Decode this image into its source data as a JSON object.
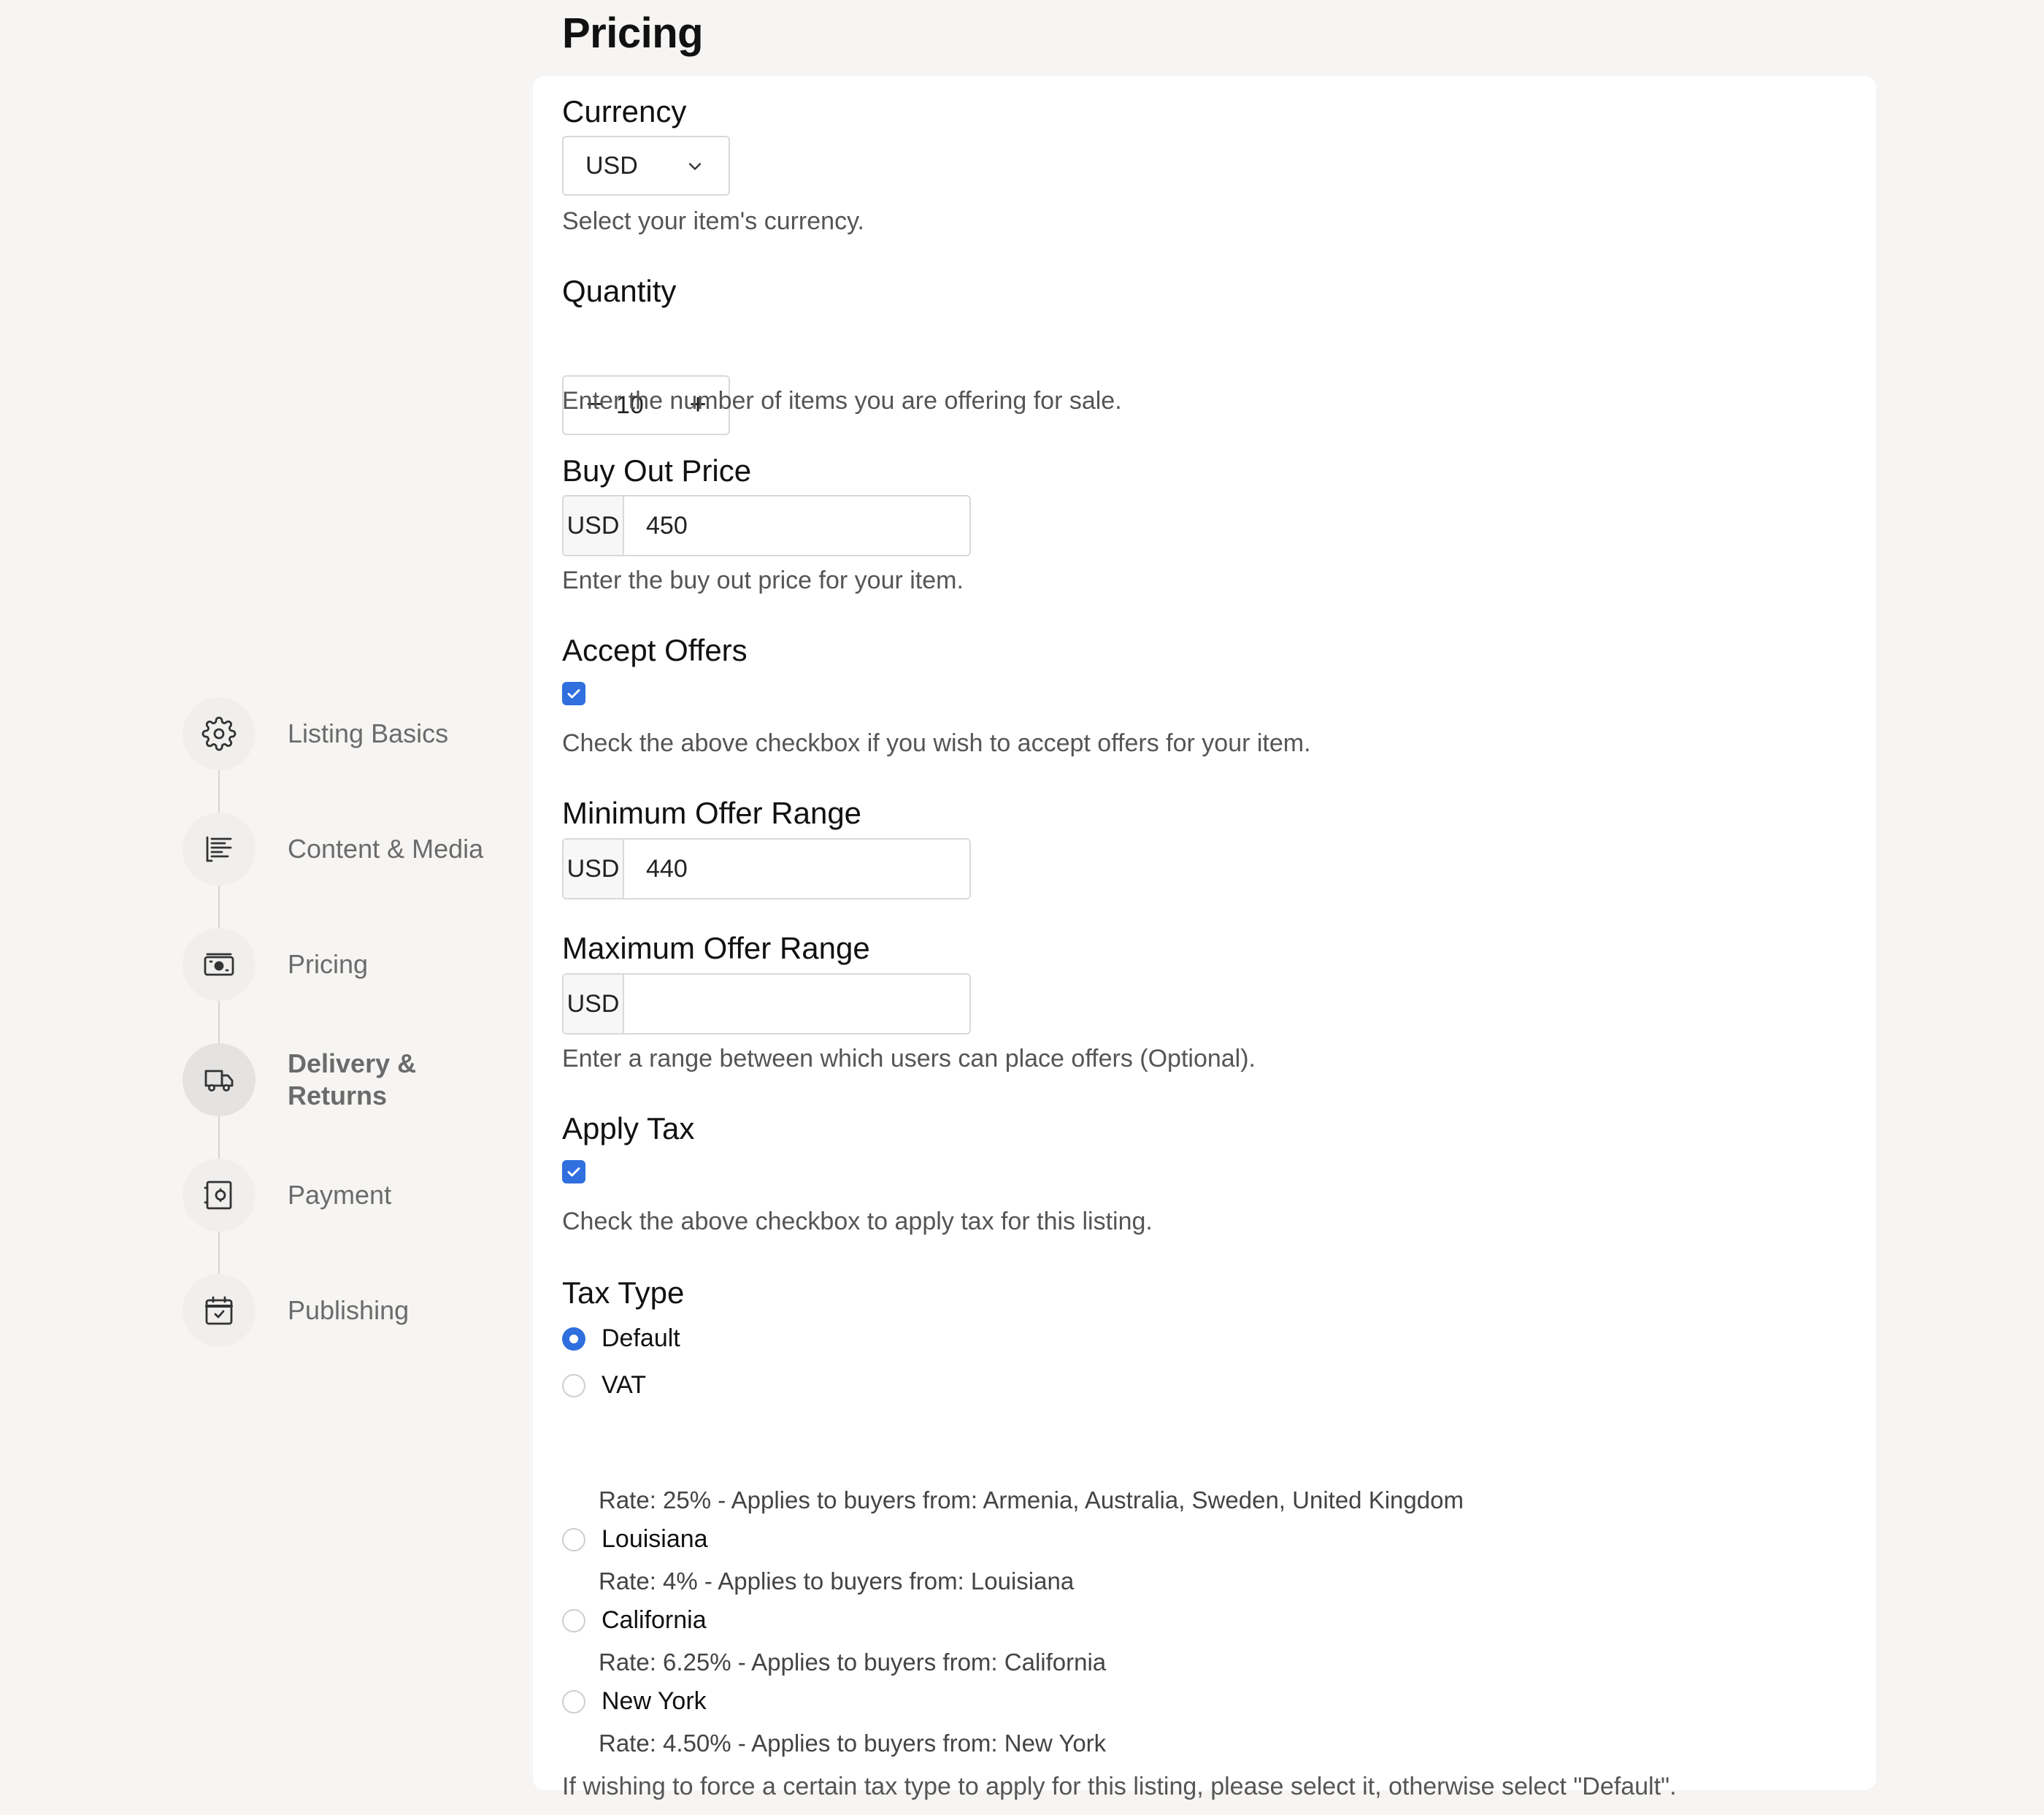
{
  "page": {
    "title": "Pricing"
  },
  "sidebar": {
    "steps": [
      {
        "label": "Listing Basics",
        "icon": "gear-icon"
      },
      {
        "label": "Content & Media",
        "icon": "text-lines-icon"
      },
      {
        "label": "Pricing",
        "icon": "banknote-icon"
      },
      {
        "label": "Delivery & Returns",
        "label_line1": "Delivery &",
        "label_line2": "Returns",
        "icon": "truck-icon",
        "active": true
      },
      {
        "label": "Payment",
        "icon": "safe-icon"
      },
      {
        "label": "Publishing",
        "icon": "calendar-check-icon"
      }
    ]
  },
  "form": {
    "currency": {
      "label": "Currency",
      "value": "USD",
      "help": "Select your item's currency."
    },
    "quantity": {
      "label": "Quantity",
      "value": "10",
      "minus": "−",
      "plus": "+",
      "help": "Enter the number of items you are offering for sale."
    },
    "buy_out_price": {
      "label": "Buy Out Price",
      "currency": "USD",
      "value": "450",
      "help": "Enter the buy out price for your item."
    },
    "accept_offers": {
      "label": "Accept Offers",
      "checked": true,
      "help": "Check the above checkbox if you wish to accept offers for your item."
    },
    "min_offer": {
      "label": "Minimum Offer Range",
      "currency": "USD",
      "value": "440"
    },
    "max_offer": {
      "label": "Maximum Offer Range",
      "currency": "USD",
      "value": "",
      "help": "Enter a range between which users can place offers (Optional)."
    },
    "apply_tax": {
      "label": "Apply Tax",
      "checked": true,
      "help": "Check the above checkbox to apply tax for this listing."
    },
    "tax_type": {
      "label": "Tax Type",
      "selected": "Default",
      "options": [
        {
          "label": "Default",
          "desc": ""
        },
        {
          "label": "VAT",
          "desc": "Rate: 25% - Applies to buyers from: Armenia, Australia, Sweden, United Kingdom"
        },
        {
          "label": "Louisiana",
          "desc": "Rate: 4% - Applies to buyers from: Louisiana"
        },
        {
          "label": "California",
          "desc": "Rate: 6.25% - Applies to buyers from: California"
        },
        {
          "label": "New York",
          "desc": "Rate: 4.50% - Applies to buyers from: New York"
        }
      ],
      "help": "If wishing to force a certain tax type to apply for this listing, please select it, otherwise select \"Default\"."
    }
  },
  "colors": {
    "accent": "#2f6fde",
    "background": "#f6f5f3",
    "card": "#ffffff"
  }
}
